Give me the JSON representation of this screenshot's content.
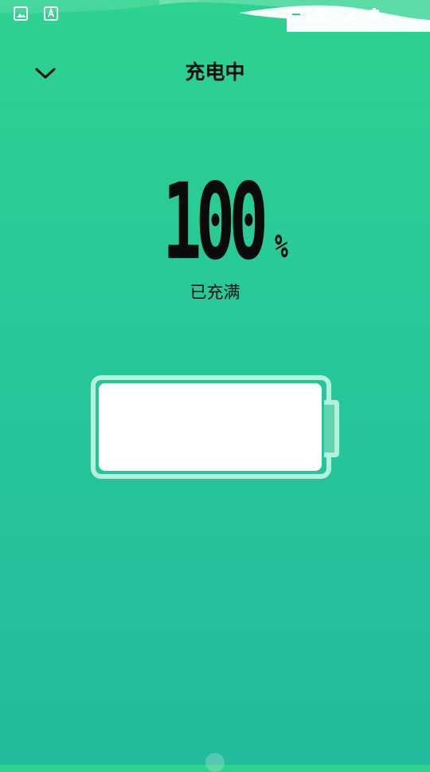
{
  "header": {
    "title": "充电中",
    "back_icon": "chevron-down-icon"
  },
  "battery": {
    "percent": "100",
    "unit": "%",
    "status": "已充满",
    "level": 1.0
  },
  "colors": {
    "background_top": "#2dd28f",
    "background_bottom": "#22bb9b",
    "battery_outline": "#b4f0db",
    "battery_fill": "#ffffff",
    "text": "#111111"
  },
  "status_bar": {
    "left_icons": [
      "image-icon",
      "text-recognition-icon"
    ],
    "right_icons": [
      "do-not-disturb-icon",
      "wifi-icon",
      "signal-icon",
      "battery-icon"
    ]
  }
}
